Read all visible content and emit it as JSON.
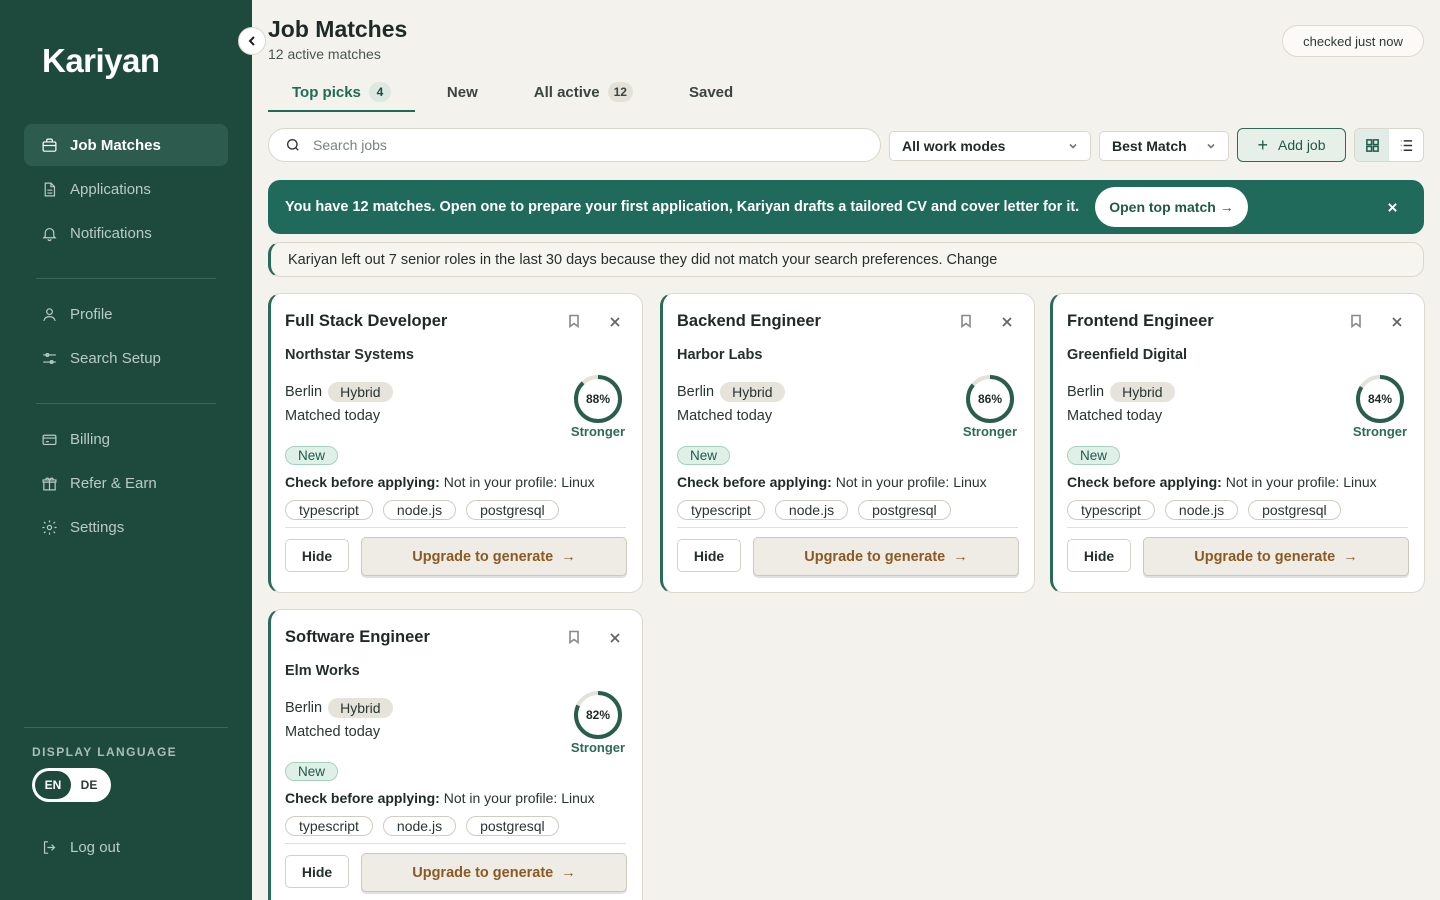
{
  "app": {
    "name": "Kariyan"
  },
  "sidebar": {
    "items": [
      {
        "label": "Job Matches",
        "icon": "briefcase-icon",
        "active": true
      },
      {
        "label": "Applications",
        "icon": "document-icon"
      },
      {
        "label": "Notifications",
        "icon": "bell-icon"
      },
      {
        "label": "Profile",
        "icon": "user-icon"
      },
      {
        "label": "Search Setup",
        "icon": "sliders-icon"
      },
      {
        "label": "Billing",
        "icon": "credit-card-icon"
      },
      {
        "label": "Refer & Earn",
        "icon": "gift-icon"
      },
      {
        "label": "Settings",
        "icon": "gear-icon"
      }
    ],
    "language": {
      "label": "DISPLAY LANGUAGE",
      "options": [
        "EN",
        "DE"
      ],
      "selected": "EN"
    },
    "logout": "Log out"
  },
  "header": {
    "title": "Job Matches",
    "subtitle": "12 active matches",
    "status": "checked just now"
  },
  "tabs": [
    {
      "label": "Top picks",
      "count": "4",
      "active": true
    },
    {
      "label": "New",
      "count": ""
    },
    {
      "label": "All active",
      "count": "12"
    },
    {
      "label": "Saved",
      "count": ""
    }
  ],
  "toolbar": {
    "search_placeholder": "Search jobs",
    "work_mode": "All work modes",
    "sort": "Best Match",
    "add_job": "Add job"
  },
  "banner": {
    "text": "You have 12 matches. Open one to prepare your first application, Kariyan drafts a tailored CV and cover letter for it.",
    "button": "Open top match →"
  },
  "notice": {
    "text": "Kariyan left out 7 senior roles in the last 30 days because they did not match your search preferences. Change"
  },
  "cards": [
    {
      "title": "Full Stack Developer",
      "company": "Northstar Systems",
      "location": "Berlin",
      "mode": "Hybrid",
      "matched": "Matched today",
      "score": 88,
      "score_label": "88%",
      "strength": "Stronger",
      "status": "New",
      "check_label": "Check before applying:",
      "check_text": "Not in your profile: Linux",
      "skills": [
        "typescript",
        "node.js",
        "postgresql"
      ],
      "hide": "Hide",
      "upgrade": "Upgrade to generate"
    },
    {
      "title": "Backend Engineer",
      "company": "Harbor Labs",
      "location": "Berlin",
      "mode": "Hybrid",
      "matched": "Matched today",
      "score": 86,
      "score_label": "86%",
      "strength": "Stronger",
      "status": "New",
      "check_label": "Check before applying:",
      "check_text": "Not in your profile: Linux",
      "skills": [
        "typescript",
        "node.js",
        "postgresql"
      ],
      "hide": "Hide",
      "upgrade": "Upgrade to generate"
    },
    {
      "title": "Frontend Engineer",
      "company": "Greenfield Digital",
      "location": "Berlin",
      "mode": "Hybrid",
      "matched": "Matched today",
      "score": 84,
      "score_label": "84%",
      "strength": "Stronger",
      "status": "New",
      "check_label": "Check before applying:",
      "check_text": "Not in your profile: Linux",
      "skills": [
        "typescript",
        "node.js",
        "postgresql"
      ],
      "hide": "Hide",
      "upgrade": "Upgrade to generate"
    },
    {
      "title": "Software Engineer",
      "company": "Elm Works",
      "location": "Berlin",
      "mode": "Hybrid",
      "matched": "Matched today",
      "score": 82,
      "score_label": "82%",
      "strength": "Stronger",
      "status": "New",
      "check_label": "Check before applying:",
      "check_text": "Not in your profile: Linux",
      "skills": [
        "typescript",
        "node.js",
        "postgresql"
      ],
      "hide": "Hide",
      "upgrade": "Upgrade to generate"
    }
  ],
  "colors": {
    "sidebar": "#1e4a3e",
    "accent": "#1f6a5a",
    "upgrade_text": "#8a5a22"
  }
}
